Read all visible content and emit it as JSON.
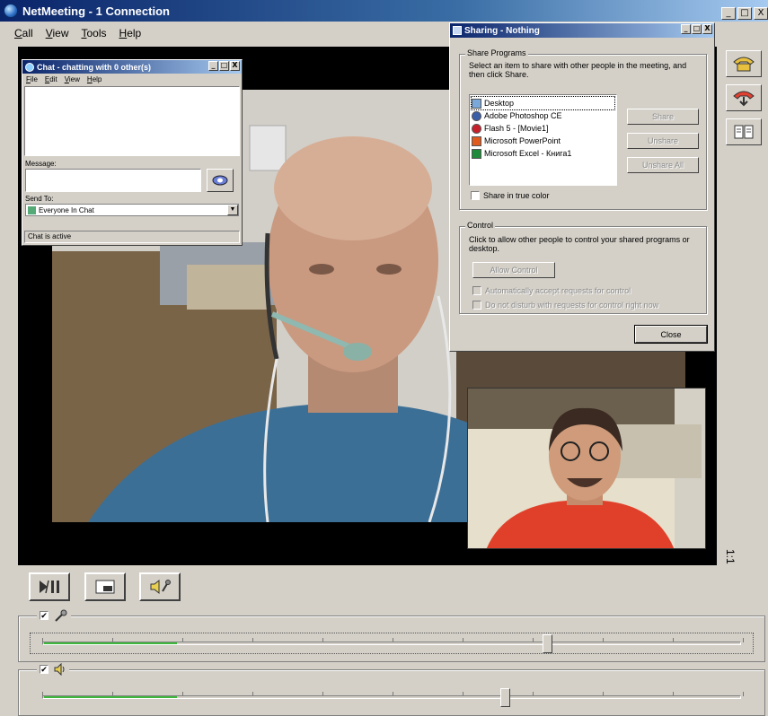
{
  "main": {
    "title": "NetMeeting - 1 Connection",
    "caption_min": "_",
    "caption_max": "□",
    "caption_close": "X",
    "menu": [
      "Call",
      "View",
      "Tools",
      "Help"
    ]
  },
  "chat": {
    "title": "Chat - chatting with 0 other(s)",
    "menu": [
      "File",
      "Edit",
      "View",
      "Help"
    ],
    "message_label": "Message:",
    "send_to_label": "Send To:",
    "send_to_value": "Everyone In Chat",
    "status": "Chat is active"
  },
  "sharing": {
    "title": "Sharing - Nothing",
    "share_programs_legend": "Share Programs",
    "instructions": "Select an item to share with other people in the meeting, and then click Share.",
    "programs": [
      "Desktop",
      "Adobe Photoshop CE",
      "Flash 5 - [Movie1]",
      "Microsoft PowerPoint",
      "Microsoft Excel - Книга1"
    ],
    "share_button": "Share",
    "unshare_button": "Unshare",
    "unshare_all_button": "Unshare All",
    "true_color_label": "Share in true color",
    "control_legend": "Control",
    "control_text": "Click to allow other people to control your shared programs or desktop.",
    "allow_control_button": "Allow Control",
    "auto_accept_label": "Automatically accept requests for control",
    "do_not_disturb_label": "Do not disturb with requests for control right now",
    "close_button": "Close"
  },
  "side_number": "1:1",
  "audio": {
    "microphone": {
      "checked": "✔",
      "level_percent": 19,
      "volume_percent": 72
    },
    "speaker": {
      "checked": "✔",
      "level_percent": 19,
      "volume_percent": 66
    }
  },
  "colors": {
    "title_bar": "#0a246a",
    "level": "#3db83d",
    "window_face": "#d4d0c8"
  }
}
